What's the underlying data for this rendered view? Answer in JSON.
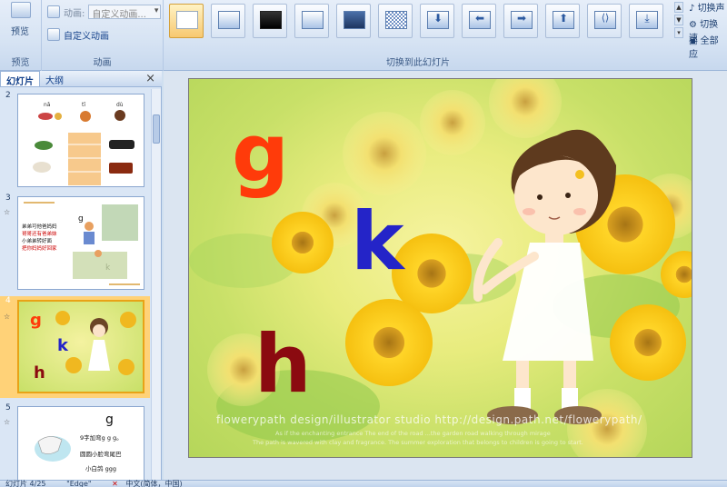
{
  "ribbon": {
    "preview_label": "预览",
    "preview_group": "预览",
    "animation_label": "动画:",
    "animation_value": "自定义动画...",
    "custom_animation": "自定义动画",
    "animation_group": "动画",
    "transition_group": "切换到此幻灯片",
    "right_items": [
      "切换声",
      "切换速",
      "全部应"
    ]
  },
  "pane": {
    "tab_slides": "幻灯片",
    "tab_outline": "大纲",
    "close": "×",
    "slides": [
      {
        "num": "2",
        "star": ""
      },
      {
        "num": "3",
        "star": "☆"
      },
      {
        "num": "4",
        "star": "☆"
      },
      {
        "num": "5",
        "star": "☆"
      }
    ],
    "s2": {
      "labels": [
        "nǎ",
        "tī",
        "dù"
      ]
    },
    "s3": {
      "letter_g": "g",
      "letter_k": "k",
      "lines": [
        "弟弟可他爸妈妈",
        "哥哥还有爸弟妹",
        "小弟弟转好面",
        "把你妈妈好回家"
      ]
    },
    "s4": {
      "g": "g",
      "k": "k",
      "h": "h"
    },
    "s5": {
      "letter": "g",
      "lines": [
        "9字加弯g g g。",
        "圆圆小脸弯尾巴",
        "小白鸽  ggg"
      ]
    }
  },
  "slide": {
    "letter_g": "g",
    "letter_k": "k",
    "letter_h": "h",
    "watermark": "flowerypath design/illustrator studio    http://design.path.net/flowerypath/",
    "watermark_small1": "As if the enchanting entrance  The end of the road ...the garden road walking through mirage",
    "watermark_small2": "The path is wavered with clay and fragrance. The summer exploration that belongs to children is going to start."
  },
  "status": {
    "slide_info": "幻灯片 4/25",
    "theme": "\"Edge\"",
    "language": "中文(简体，中国)"
  },
  "colors": {
    "g": "#ff3b0a",
    "k": "#2424c8",
    "h": "#8b0a10"
  }
}
